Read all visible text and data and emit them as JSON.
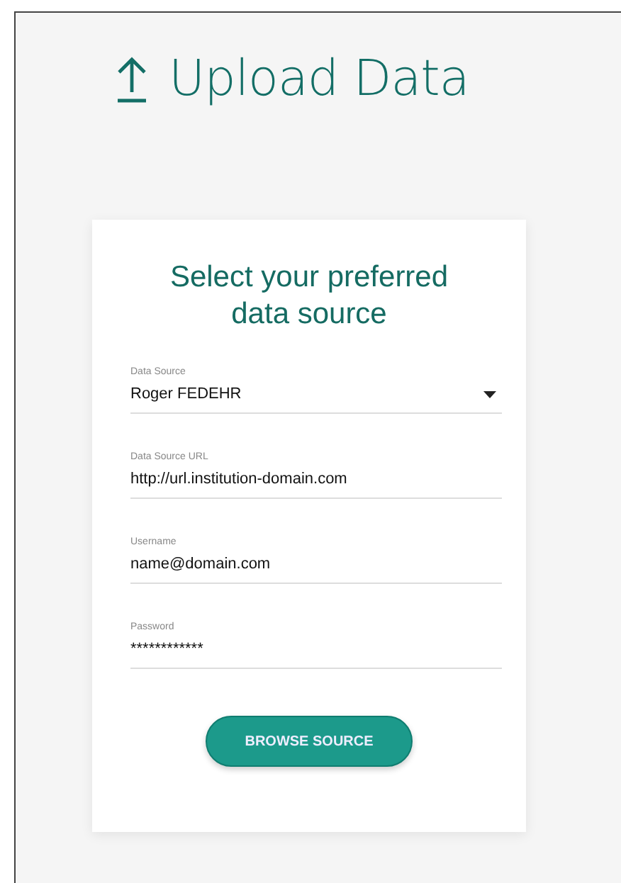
{
  "page": {
    "title": "Upload Data"
  },
  "card": {
    "heading": "Select your preferred data source",
    "fields": [
      {
        "kind": "select",
        "label": "Data Source",
        "value": "Roger FEDEHR"
      },
      {
        "kind": "text",
        "label": "Data Source URL",
        "value": "http://url.institution-domain.com"
      },
      {
        "kind": "text",
        "label": "Username",
        "value": "name@domain.com"
      },
      {
        "kind": "text",
        "label": "Password",
        "value": "************"
      }
    ],
    "button": "BROWSE SOURCE"
  }
}
